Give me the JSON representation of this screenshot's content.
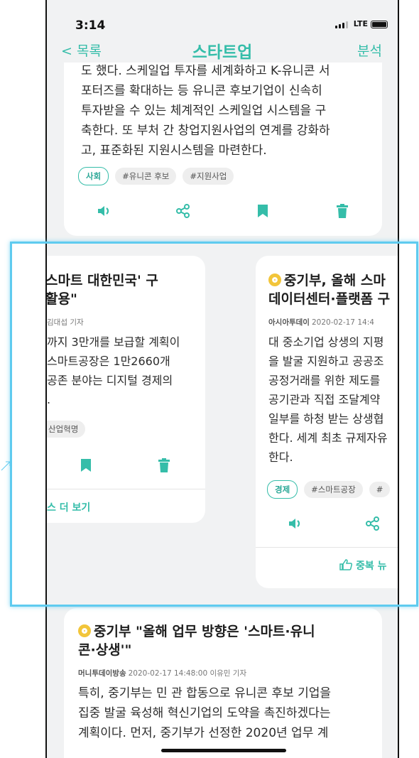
{
  "status": {
    "time": "3:14",
    "network": "LTE"
  },
  "nav": {
    "back_label": "< 목록",
    "title": "스타트업",
    "action_label": "분석"
  },
  "top_card": {
    "lines": [
      "도 했다. 스케일업 투자를 세계화하고 K-유니콘 서",
      "포터즈를 확대하는 등 유니콘 후보기업이 신속히",
      "투자받을 수 있는 체계적인 스케일업 시스템을 구",
      "축한다. 또 부처 간 창업지원사업의 연계를 강화하",
      "고, 표준화된 지원시스템을 마련한다."
    ],
    "category": "사회",
    "tags": [
      "#유니콘 후보",
      "#지원사업"
    ]
  },
  "left_card": {
    "title_lines": [
      "스마트 대한민국' 구",
      "활용\""
    ],
    "meta": "김대섭 기자",
    "lines": [
      "까지 3만개를 보급할 계획이",
      "스마트공장은 1만2660개",
      "공존 분야는 디지털 경제의",
      "."
    ],
    "tags": [
      "산업혁명"
    ],
    "more_link": "스 더 보기"
  },
  "right_card": {
    "title_lines": [
      "중기부, 올해 스마",
      "데이터센터·플랫폼 구"
    ],
    "source": "아시아투데이",
    "meta": "2020-02-17 14:4",
    "lines": [
      "대 중소기업 상생의 지평",
      "을 발굴 지원하고 공공조",
      "공정거래를 위한 제도를",
      "공기관과 직접 조달계약",
      "일부를 하청 받는 상생협",
      "한다. 세계 최초 규제자유",
      "한다."
    ],
    "category": "경제",
    "tags": [
      "#스마트공장",
      "#"
    ],
    "dup_link": "중복 뉴"
  },
  "bottom_card": {
    "title_lines": [
      "중기부 \"올해 업무 방향은 '스마트·유니",
      "콘·상생'\""
    ],
    "source": "머니투데이방송",
    "meta": "2020-02-17 14:48:00 이유민 기자",
    "lines": [
      "특히, 중기부는 민 관 합동으로 유니콘 후보 기업을",
      "집중 발굴 육성해 혁신기업의 도약을 촉진하겠다는",
      "계획이다. 먼저, 중기부가 선정한 2020년 업무 계"
    ]
  },
  "colors": {
    "accent": "#35bda9",
    "highlight_border": "#5fcbef",
    "badge": "#f2c53a"
  }
}
